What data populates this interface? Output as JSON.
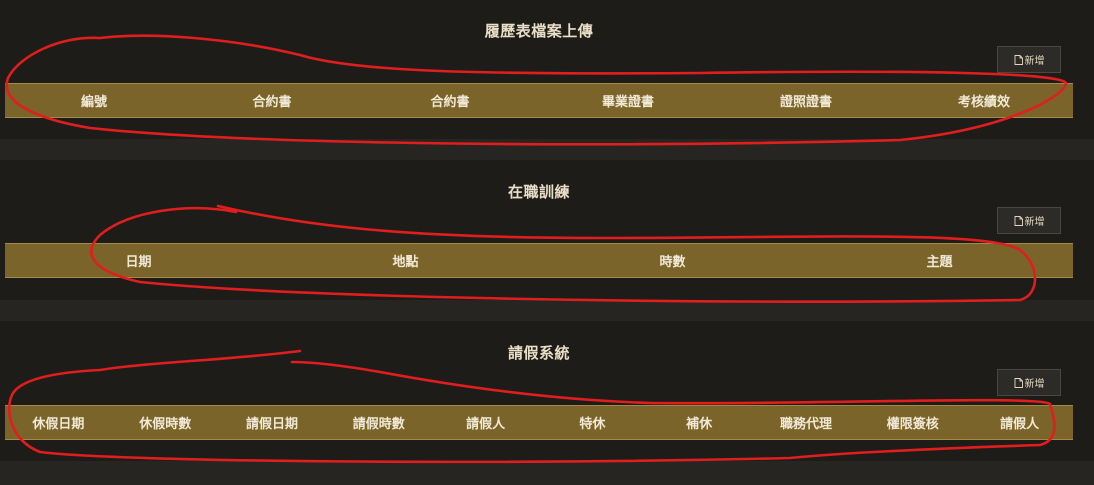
{
  "sections": [
    {
      "title": "履歷表檔案上傳",
      "add_label": "新增",
      "columns": [
        "編號",
        "合約書",
        "合約書",
        "畢業證書",
        "證照證書",
        "考核績效"
      ]
    },
    {
      "title": "在職訓練",
      "add_label": "新增",
      "columns": [
        "日期",
        "地點",
        "時數",
        "主題"
      ]
    },
    {
      "title": "請假系統",
      "add_label": "新增",
      "columns": [
        "休假日期",
        "休假時數",
        "請假日期",
        "請假時數",
        "請假人",
        "特休",
        "補休",
        "職務代理",
        "權限簽核",
        "請假人"
      ]
    }
  ],
  "colors": {
    "page_bg": "#262522",
    "panel_bg": "#1e1c19",
    "header_bg": "#7a6429",
    "header_text": "#f1e9d6",
    "title_text": "#e9dfc6",
    "annotation_stroke": "#e01e1e"
  },
  "icons": {
    "add_button_icon": "document-icon"
  }
}
